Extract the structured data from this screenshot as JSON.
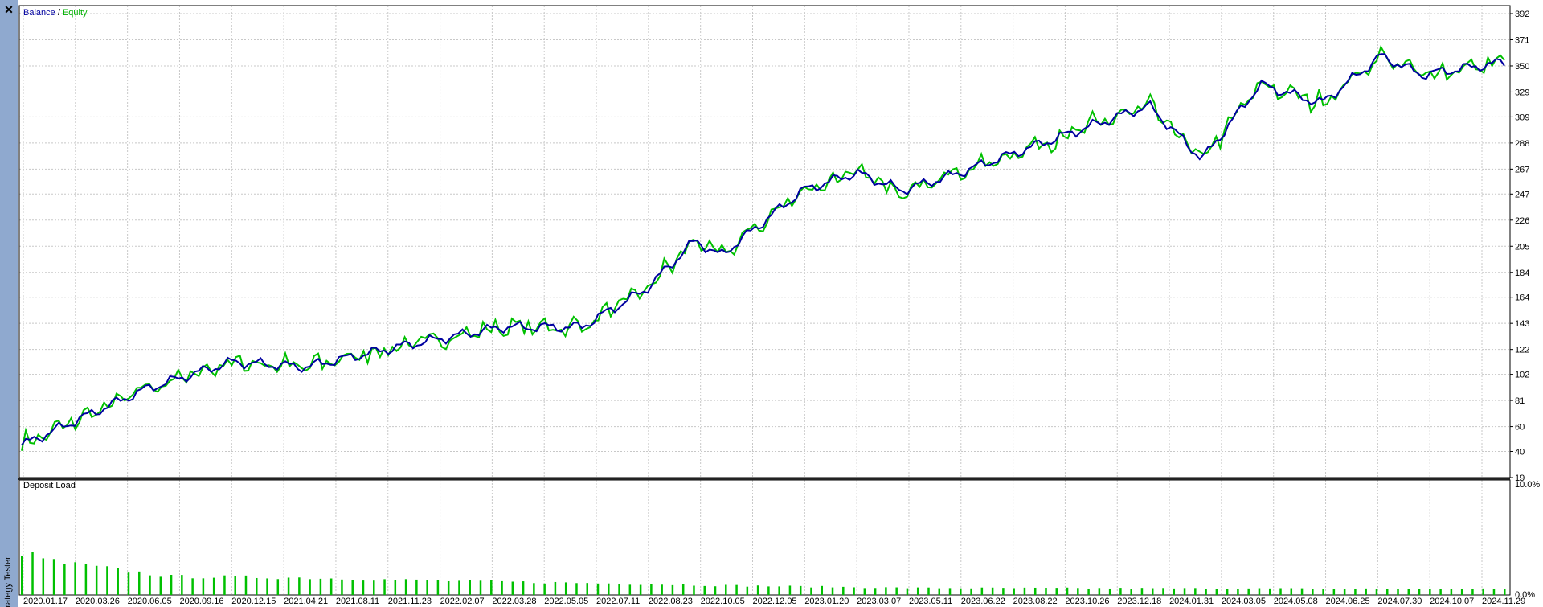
{
  "window": {
    "close_icon": "close-icon",
    "side_label": "Strategy Tester"
  },
  "chart_data": [
    {
      "type": "line",
      "title_parts": [
        "Balance",
        " / ",
        "Equity"
      ],
      "series": [
        {
          "name": "Balance",
          "color": "#0000a0"
        },
        {
          "name": "Equity",
          "color": "#00c000"
        }
      ],
      "x_range": [
        "2020.01.01",
        "2024.12.31"
      ],
      "ylim": [
        19,
        392
      ],
      "yticks": [
        392,
        371,
        350,
        329,
        309,
        288,
        267,
        247,
        226,
        205,
        184,
        164,
        143,
        122,
        102,
        81,
        60,
        40,
        19
      ],
      "grid": true,
      "trend_points": [
        [
          "2020.01.01",
          45
        ],
        [
          "2020.06.01",
          90
        ],
        [
          "2020.09.15",
          112
        ],
        [
          "2020.12.15",
          108
        ],
        [
          "2021.04.15",
          125
        ],
        [
          "2021.08.15",
          140
        ],
        [
          "2021.11.20",
          140
        ],
        [
          "2022.02.07",
          170
        ],
        [
          "2022.04.10",
          210
        ],
        [
          "2022.05.10",
          197
        ],
        [
          "2022.08.20",
          250
        ],
        [
          "2022.10.25",
          264
        ],
        [
          "2022.12.20",
          250
        ],
        [
          "2023.02.20",
          262
        ],
        [
          "2023.06.20",
          290
        ],
        [
          "2023.10.20",
          318
        ],
        [
          "2023.12.25",
          275
        ],
        [
          "2024.03.05",
          335
        ],
        [
          "2024.05.20",
          320
        ],
        [
          "2024.08.01",
          358
        ],
        [
          "2024.09.20",
          343
        ],
        [
          "2024.12.31",
          353
        ]
      ]
    },
    {
      "type": "bar",
      "title": "Deposit Load",
      "color": "#00c000",
      "ylim": [
        0,
        10
      ],
      "yticks": [
        "10.0%",
        "0.0%"
      ],
      "trend_points": [
        [
          "2020.01.01",
          3.9
        ],
        [
          "2020.02.15",
          3.0
        ],
        [
          "2020.05.01",
          2.3
        ],
        [
          "2020.07.01",
          1.7
        ],
        [
          "2020.12.01",
          1.6
        ],
        [
          "2021.06.01",
          1.3
        ],
        [
          "2022.01.01",
          1.05
        ],
        [
          "2022.06.01",
          0.85
        ],
        [
          "2023.01.01",
          0.65
        ],
        [
          "2024.12.31",
          0.55
        ]
      ],
      "bar_count": 140
    }
  ],
  "x_axis": {
    "ticks": [
      "2020.01.17",
      "2020.03.26",
      "2020.06.05",
      "2020.09.16",
      "2020.12.15",
      "2021.04.21",
      "2021.08.11",
      "2021.11.23",
      "2022.02.07",
      "2022.03.28",
      "2022.05.05",
      "2022.07.11",
      "2022.08.23",
      "2022.10.05",
      "2022.12.05",
      "2023.01.20",
      "2023.03.07",
      "2023.05.11",
      "2023.06.22",
      "2023.08.22",
      "2023.10.26",
      "2023.12.18",
      "2024.01.31",
      "2024.03.05",
      "2024.05.08",
      "2024.06.25",
      "2024.07.30",
      "2024.10.07",
      "2024.11.29"
    ]
  }
}
